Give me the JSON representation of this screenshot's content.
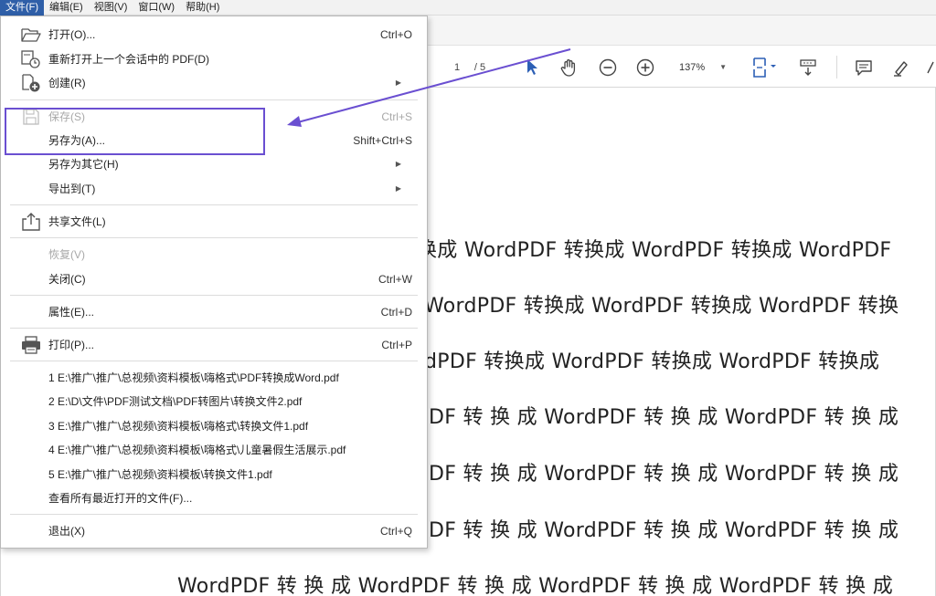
{
  "menubar": {
    "items": [
      "文件(F)",
      "编辑(E)",
      "视图(V)",
      "窗口(W)",
      "帮助(H)"
    ]
  },
  "toolbar": {
    "page_current": "1",
    "page_total": "/ 5",
    "zoom": "137%"
  },
  "file_menu": {
    "open": {
      "label": "打开(O)...",
      "shortcut": "Ctrl+O"
    },
    "reopen": {
      "label": "重新打开上一个会话中的 PDF(D)"
    },
    "create": {
      "label": "创建(R)"
    },
    "save": {
      "label": "保存(S)",
      "shortcut": "Ctrl+S"
    },
    "save_as": {
      "label": "另存为(A)...",
      "shortcut": "Shift+Ctrl+S"
    },
    "save_as_other": {
      "label": "另存为其它(H)"
    },
    "export_to": {
      "label": "导出到(T)"
    },
    "share": {
      "label": "共享文件(L)"
    },
    "revert": {
      "label": "恢复(V)"
    },
    "close": {
      "label": "关闭(C)",
      "shortcut": "Ctrl+W"
    },
    "properties": {
      "label": "属性(E)...",
      "shortcut": "Ctrl+D"
    },
    "print": {
      "label": "打印(P)...",
      "shortcut": "Ctrl+P"
    },
    "recent": [
      "1 E:\\推广\\推广\\总视频\\资料模板\\嗨格式\\PDF转换成Word.pdf",
      "2 E:\\D\\文件\\PDF测试文档\\PDF转图片\\转换文件2.pdf",
      "3 E:\\推广\\推广\\总视频\\资料模板\\嗨格式\\转换文件1.pdf",
      "4 E:\\推广\\推广\\总视频\\资料模板\\嗨格式\\儿童暑假生活展示.pdf",
      "5 E:\\推广\\推广\\总视频\\资料模板\\转换文件1.pdf"
    ],
    "view_all_recent": {
      "label": "查看所有最近打开的文件(F)..."
    },
    "exit": {
      "label": "退出(X)",
      "shortcut": "Ctrl+Q"
    }
  },
  "document": {
    "lines": [
      "换成 WordPDF 转换成 WordPDF 转换成 WordPDF",
      "WordPDF 转换成 WordPDF 转换成 WordPDF 转换",
      "dPDF 转换成 WordPDF 转换成 WordPDF 转换成",
      "DF 转 换 成 WordPDF 转 换 成 WordPDF 转 换 成",
      "DF 转 换 成 WordPDF 转 换 成 WordPDF 转 换 成",
      "DF 转 换 成 WordPDF 转 换 成 WordPDF 转 换 成",
      "WordPDF 转 换 成 WordPDF 转 换 成 WordPDF 转 换 成 WordPDF 转 换 成"
    ]
  },
  "colors": {
    "highlight": "#6a4fd1",
    "menubar_active": "#2f5fa8",
    "disabled_text": "#a8a8a8"
  }
}
